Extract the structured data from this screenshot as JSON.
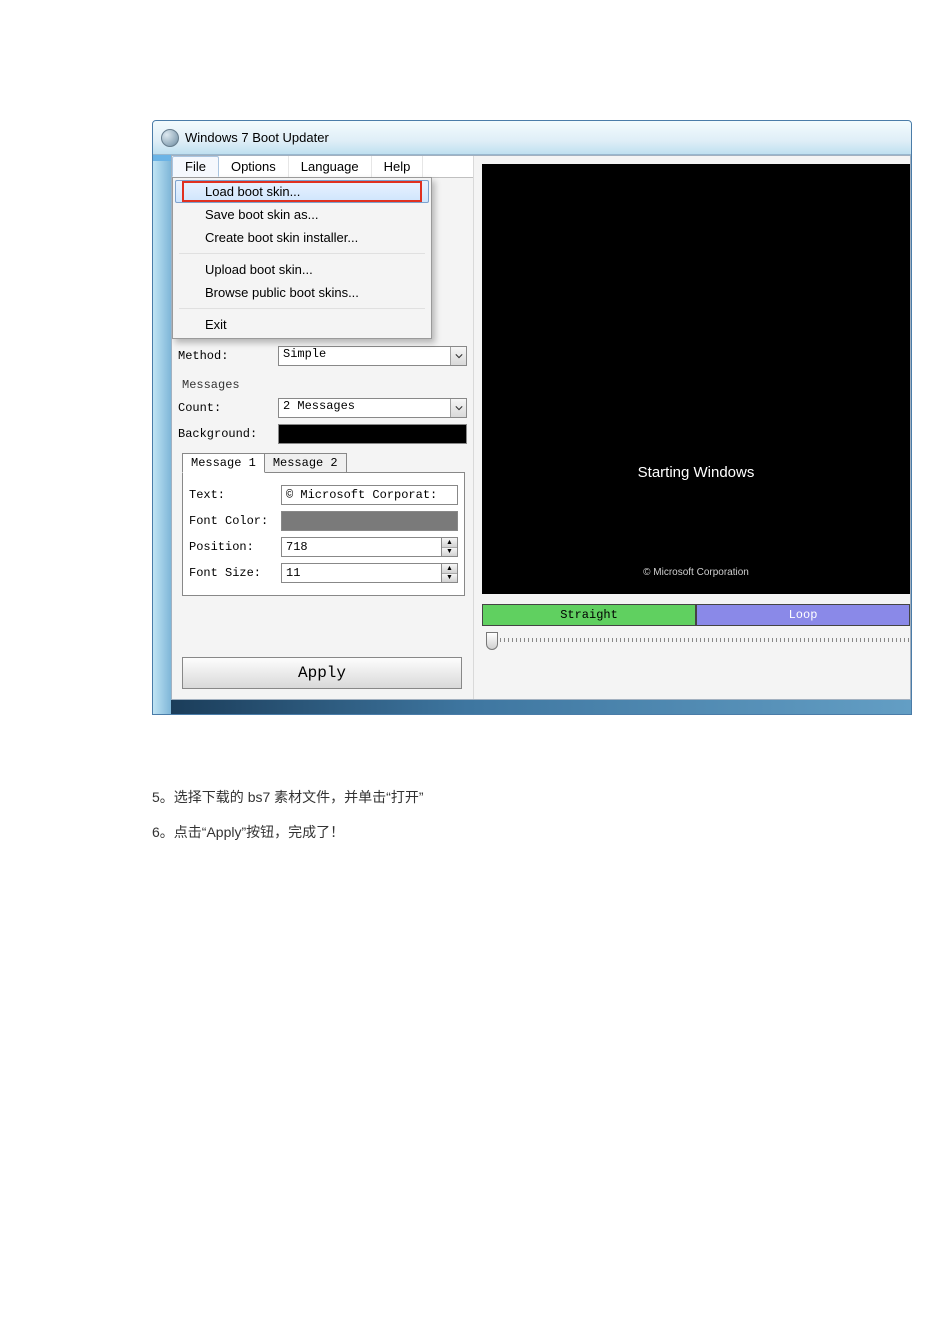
{
  "window": {
    "title": "Windows 7 Boot Updater"
  },
  "menubar": {
    "items": [
      "File",
      "Options",
      "Language",
      "Help"
    ]
  },
  "file_menu": {
    "items": [
      "Load boot skin...",
      "Save boot skin as...",
      "Create boot skin installer...",
      "Upload boot skin...",
      "Browse public boot skins...",
      "Exit"
    ],
    "highlighted_index": 0
  },
  "form": {
    "method_label": "Method:",
    "method_value": "Simple",
    "messages_group_label": "Messages",
    "count_label": "Count:",
    "count_value": "2 Messages",
    "background_label": "Background:",
    "tabs": [
      "Message 1",
      "Message 2"
    ],
    "active_tab": 0,
    "text_label": "Text:",
    "text_value": "© Microsoft Corporat:",
    "fontcolor_label": "Font Color:",
    "position_label": "Position:",
    "position_value": "718",
    "fontsize_label": "Font Size:",
    "fontsize_value": "11",
    "apply_label": "Apply"
  },
  "preview": {
    "starting_text": "Starting Windows",
    "copyright_text": "© Microsoft Corporation",
    "straight_label": "Straight",
    "loop_label": "Loop"
  },
  "article": {
    "step5_num": "5。",
    "step5_text_a": "选择下载的 ",
    "step5_text_b": "bs7",
    "step5_text_c": " 素材文件，并单击“打开”",
    "step6_num": "6。",
    "step6_text_a": "点击“",
    "step6_text_b": "Apply",
    "step6_text_c": "”按钮，完成了！"
  }
}
